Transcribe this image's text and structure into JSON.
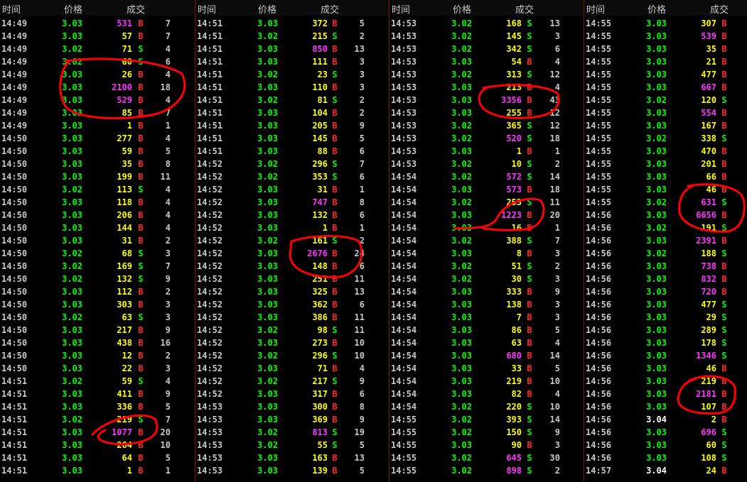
{
  "colors": {
    "up": "#00ff00",
    "flat": "#ffffff",
    "vol_normal": "#ffff00",
    "vol_big": "#ff33ff",
    "buy": "#ff2a2a",
    "sell": "#00ff00",
    "count": "#c8c8c8",
    "annotation": "#ff0000"
  },
  "panels": [
    {
      "headers": {
        "time": "时间",
        "price": "价格",
        "vol": "成交"
      },
      "rows": [
        [
          "14:49",
          "3.03",
          "531",
          "B",
          "7"
        ],
        [
          "14:49",
          "3.03",
          "57",
          "B",
          "7"
        ],
        [
          "14:49",
          "3.02",
          "71",
          "S",
          "4"
        ],
        [
          "14:49",
          "3.02",
          "60",
          "S",
          "6"
        ],
        [
          "14:49",
          "3.03",
          "26",
          "B",
          "4"
        ],
        [
          "14:49",
          "3.03",
          "2100",
          "B",
          "18"
        ],
        [
          "14:49",
          "3.03",
          "529",
          "B",
          "4"
        ],
        [
          "14:49",
          "3.03",
          "85",
          "B",
          "7"
        ],
        [
          "14:49",
          "3.03",
          "1",
          "B",
          "1"
        ],
        [
          "14:50",
          "3.03",
          "277",
          "B",
          "4"
        ],
        [
          "14:50",
          "3.03",
          "59",
          "B",
          "5"
        ],
        [
          "14:50",
          "3.03",
          "35",
          "B",
          "8"
        ],
        [
          "14:50",
          "3.03",
          "199",
          "B",
          "11"
        ],
        [
          "14:50",
          "3.02",
          "113",
          "S",
          "4"
        ],
        [
          "14:50",
          "3.03",
          "118",
          "B",
          "4"
        ],
        [
          "14:50",
          "3.03",
          "206",
          "B",
          "4"
        ],
        [
          "14:50",
          "3.03",
          "144",
          "B",
          "4"
        ],
        [
          "14:50",
          "3.03",
          "31",
          "B",
          "2"
        ],
        [
          "14:50",
          "3.02",
          "68",
          "S",
          "3"
        ],
        [
          "14:50",
          "3.02",
          "169",
          "S",
          "7"
        ],
        [
          "14:50",
          "3.02",
          "132",
          "S",
          "9"
        ],
        [
          "14:50",
          "3.03",
          "112",
          "B",
          "2"
        ],
        [
          "14:50",
          "3.03",
          "303",
          "B",
          "3"
        ],
        [
          "14:50",
          "3.02",
          "63",
          "S",
          "3"
        ],
        [
          "14:50",
          "3.03",
          "217",
          "B",
          "9"
        ],
        [
          "14:50",
          "3.03",
          "438",
          "B",
          "16"
        ],
        [
          "14:50",
          "3.03",
          "12",
          "B",
          "2"
        ],
        [
          "14:50",
          "3.03",
          "22",
          "B",
          "3"
        ],
        [
          "14:51",
          "3.02",
          "59",
          "S",
          "4"
        ],
        [
          "14:51",
          "3.03",
          "411",
          "B",
          "9"
        ],
        [
          "14:51",
          "3.03",
          "336",
          "B",
          "5"
        ],
        [
          "14:51",
          "3.02",
          "219",
          "S",
          "7"
        ],
        [
          "14:51",
          "3.03",
          "1077",
          "B",
          "20"
        ],
        [
          "14:51",
          "3.03",
          "264",
          "B",
          "10"
        ],
        [
          "14:51",
          "3.03",
          "64",
          "B",
          "5"
        ],
        [
          "14:51",
          "3.03",
          "1",
          "B",
          "1"
        ]
      ]
    },
    {
      "headers": {
        "time": "时间",
        "price": "价格",
        "vol": "成交"
      },
      "rows": [
        [
          "14:51",
          "3.03",
          "372",
          "B",
          "5"
        ],
        [
          "14:51",
          "3.02",
          "215",
          "S",
          "2"
        ],
        [
          "14:51",
          "3.03",
          "850",
          "B",
          "13"
        ],
        [
          "14:51",
          "3.03",
          "111",
          "B",
          "3"
        ],
        [
          "14:51",
          "3.02",
          "23",
          "S",
          "3"
        ],
        [
          "14:51",
          "3.03",
          "110",
          "B",
          "3"
        ],
        [
          "14:51",
          "3.02",
          "81",
          "S",
          "2"
        ],
        [
          "14:51",
          "3.03",
          "104",
          "B",
          "2"
        ],
        [
          "14:51",
          "3.03",
          "205",
          "B",
          "9"
        ],
        [
          "14:51",
          "3.03",
          "145",
          "B",
          "5"
        ],
        [
          "14:51",
          "3.03",
          "88",
          "B",
          "6"
        ],
        [
          "14:52",
          "3.02",
          "296",
          "S",
          "7"
        ],
        [
          "14:52",
          "3.02",
          "353",
          "S",
          "6"
        ],
        [
          "14:52",
          "3.03",
          "31",
          "B",
          "1"
        ],
        [
          "14:52",
          "3.03",
          "747",
          "B",
          "8"
        ],
        [
          "14:52",
          "3.03",
          "132",
          "B",
          "6"
        ],
        [
          "14:52",
          "3.03",
          "1",
          "B",
          "1"
        ],
        [
          "14:52",
          "3.02",
          "161",
          "S",
          "2"
        ],
        [
          "14:52",
          "3.03",
          "2676",
          "B",
          "24"
        ],
        [
          "14:52",
          "3.03",
          "148",
          "B",
          "6"
        ],
        [
          "14:52",
          "3.03",
          "251",
          "B",
          "11"
        ],
        [
          "14:52",
          "3.03",
          "325",
          "B",
          "13"
        ],
        [
          "14:52",
          "3.03",
          "362",
          "B",
          "6"
        ],
        [
          "14:52",
          "3.03",
          "386",
          "B",
          "11"
        ],
        [
          "14:52",
          "3.02",
          "98",
          "S",
          "11"
        ],
        [
          "14:52",
          "3.03",
          "273",
          "B",
          "10"
        ],
        [
          "14:52",
          "3.02",
          "296",
          "S",
          "10"
        ],
        [
          "14:52",
          "3.03",
          "71",
          "B",
          "4"
        ],
        [
          "14:52",
          "3.02",
          "217",
          "S",
          "9"
        ],
        [
          "14:52",
          "3.03",
          "317",
          "B",
          "6"
        ],
        [
          "14:53",
          "3.03",
          "300",
          "B",
          "8"
        ],
        [
          "14:53",
          "3.03",
          "369",
          "B",
          "9"
        ],
        [
          "14:53",
          "3.02",
          "813",
          "S",
          "19"
        ],
        [
          "14:53",
          "3.02",
          "55",
          "S",
          "5"
        ],
        [
          "14:53",
          "3.03",
          "163",
          "B",
          "13"
        ],
        [
          "14:53",
          "3.03",
          "139",
          "B",
          "5"
        ]
      ]
    },
    {
      "headers": {
        "time": "时间",
        "price": "价格",
        "vol": "成交"
      },
      "rows": [
        [
          "14:53",
          "3.02",
          "168",
          "S",
          "13"
        ],
        [
          "14:53",
          "3.02",
          "145",
          "S",
          "3"
        ],
        [
          "14:53",
          "3.02",
          "342",
          "S",
          "6"
        ],
        [
          "14:53",
          "3.03",
          "54",
          "B",
          "4"
        ],
        [
          "14:53",
          "3.02",
          "313",
          "S",
          "12"
        ],
        [
          "14:53",
          "3.03",
          "213",
          "B",
          "4"
        ],
        [
          "14:53",
          "3.03",
          "3356",
          "B",
          "43"
        ],
        [
          "14:53",
          "3.03",
          "255",
          "B",
          "12"
        ],
        [
          "14:53",
          "3.02",
          "365",
          "S",
          "12"
        ],
        [
          "14:53",
          "3.02",
          "520",
          "S",
          "18"
        ],
        [
          "14:53",
          "3.03",
          "1",
          "B",
          "1"
        ],
        [
          "14:53",
          "3.02",
          "10",
          "S",
          "2"
        ],
        [
          "14:54",
          "3.02",
          "572",
          "S",
          "14"
        ],
        [
          "14:54",
          "3.03",
          "573",
          "B",
          "18"
        ],
        [
          "14:54",
          "3.02",
          "253",
          "S",
          "11"
        ],
        [
          "14:54",
          "3.03",
          "1223",
          "B",
          "20"
        ],
        [
          "14:54",
          "3.03",
          "16",
          "B",
          "1"
        ],
        [
          "14:54",
          "3.02",
          "388",
          "S",
          "7"
        ],
        [
          "14:54",
          "3.03",
          "8",
          "B",
          "3"
        ],
        [
          "14:54",
          "3.02",
          "51",
          "S",
          "2"
        ],
        [
          "14:54",
          "3.02",
          "30",
          "S",
          "3"
        ],
        [
          "14:54",
          "3.03",
          "333",
          "B",
          "9"
        ],
        [
          "14:54",
          "3.03",
          "138",
          "B",
          "3"
        ],
        [
          "14:54",
          "3.03",
          "7",
          "B",
          "3"
        ],
        [
          "14:54",
          "3.03",
          "86",
          "B",
          "5"
        ],
        [
          "14:54",
          "3.03",
          "63",
          "B",
          "4"
        ],
        [
          "14:54",
          "3.03",
          "680",
          "B",
          "14"
        ],
        [
          "14:54",
          "3.03",
          "33",
          "B",
          "5"
        ],
        [
          "14:54",
          "3.03",
          "219",
          "B",
          "10"
        ],
        [
          "14:54",
          "3.03",
          "82",
          "B",
          "4"
        ],
        [
          "14:54",
          "3.02",
          "220",
          "S",
          "10"
        ],
        [
          "14:55",
          "3.02",
          "393",
          "S",
          "14"
        ],
        [
          "14:55",
          "3.02",
          "150",
          "S",
          "9"
        ],
        [
          "14:55",
          "3.03",
          "90",
          "B",
          "3"
        ],
        [
          "14:55",
          "3.02",
          "645",
          "S",
          "30"
        ],
        [
          "14:55",
          "3.02",
          "898",
          "S",
          "2"
        ]
      ]
    },
    {
      "headers": {
        "time": "时间",
        "price": "价格",
        "vol": "成交"
      },
      "rows": [
        [
          "14:55",
          "3.03",
          "307",
          "B",
          "1"
        ],
        [
          "14:55",
          "3.03",
          "539",
          "B",
          "1"
        ],
        [
          "14:55",
          "3.03",
          "35",
          "B",
          "1"
        ],
        [
          "14:55",
          "3.03",
          "21",
          "B",
          "1"
        ],
        [
          "14:55",
          "3.03",
          "477",
          "B",
          "1"
        ],
        [
          "14:55",
          "3.03",
          "667",
          "B",
          "1"
        ],
        [
          "14:55",
          "3.02",
          "120",
          "S",
          "1"
        ],
        [
          "14:55",
          "3.03",
          "554",
          "B",
          "1"
        ],
        [
          "14:55",
          "3.03",
          "167",
          "B",
          "1"
        ],
        [
          "14:55",
          "3.02",
          "338",
          "S",
          "1"
        ],
        [
          "14:55",
          "3.03",
          "470",
          "B",
          "1"
        ],
        [
          "14:55",
          "3.03",
          "201",
          "B",
          "1"
        ],
        [
          "14:55",
          "3.03",
          "66",
          "B",
          "1"
        ],
        [
          "14:55",
          "3.03",
          "46",
          "B",
          "1"
        ],
        [
          "14:55",
          "3.02",
          "631",
          "S",
          "1"
        ],
        [
          "14:56",
          "3.03",
          "6656",
          "B",
          "2"
        ],
        [
          "14:56",
          "3.02",
          "191",
          "S",
          "1"
        ],
        [
          "14:56",
          "3.03",
          "2391",
          "B",
          "5"
        ],
        [
          "14:56",
          "3.02",
          "188",
          "S",
          "1"
        ],
        [
          "14:56",
          "3.03",
          "738",
          "B",
          "1"
        ],
        [
          "14:56",
          "3.03",
          "832",
          "B",
          "1"
        ],
        [
          "14:56",
          "3.03",
          "720",
          "B",
          "1"
        ],
        [
          "14:56",
          "3.03",
          "477",
          "S",
          "1"
        ],
        [
          "14:56",
          "3.03",
          "29",
          "S",
          "1"
        ],
        [
          "14:56",
          "3.03",
          "289",
          "S",
          "1"
        ],
        [
          "14:56",
          "3.03",
          "178",
          "S",
          "1"
        ],
        [
          "14:56",
          "3.03",
          "1346",
          "S",
          "1"
        ],
        [
          "14:56",
          "3.03",
          "46",
          "B",
          "1"
        ],
        [
          "14:56",
          "3.03",
          "219",
          "B",
          "1"
        ],
        [
          "14:56",
          "3.03",
          "2181",
          "B",
          "1"
        ],
        [
          "14:56",
          "3.03",
          "107",
          "B",
          "1"
        ],
        [
          "14:56",
          "3.04",
          "2",
          "B",
          "1"
        ],
        [
          "14:56",
          "3.03",
          "696",
          "S",
          "1"
        ],
        [
          "14:56",
          "3.03",
          "60",
          "S",
          "1"
        ],
        [
          "14:56",
          "3.03",
          "108",
          "S",
          "1"
        ],
        [
          "14:57",
          "3.04",
          "24",
          "B",
          "1"
        ]
      ]
    }
  ]
}
